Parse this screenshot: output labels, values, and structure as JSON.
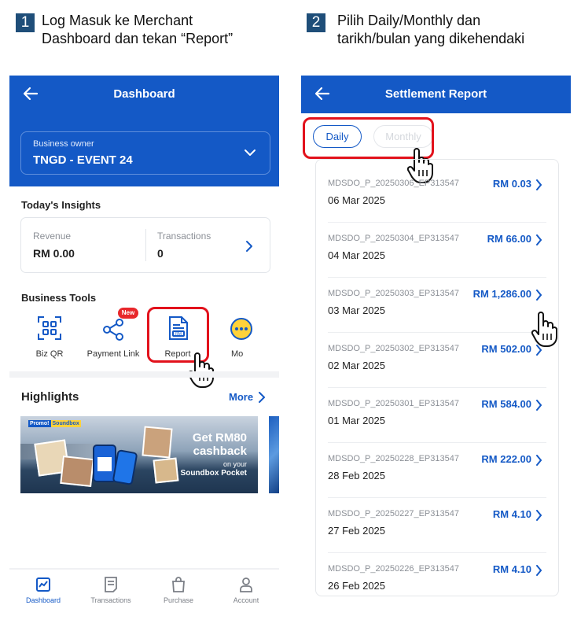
{
  "steps": [
    {
      "num": "1",
      "line1": "Log Masuk ke Merchant",
      "line2": "Dashboard dan tekan “Report”"
    },
    {
      "num": "2",
      "line1": "Pilih Daily/Monthly dan",
      "line2": "tarikh/bulan yang dikehendaki"
    }
  ],
  "dashboard": {
    "title": "Dashboard",
    "business_owner_label": "Business owner",
    "business_owner_value": "TNGD - EVENT 24",
    "insights_title": "Today's Insights",
    "revenue_label": "Revenue",
    "revenue_value": "RM 0.00",
    "transactions_label": "Transactions",
    "transactions_value": "0",
    "tools_title": "Business Tools",
    "tools": [
      {
        "label": "Biz QR",
        "icon": "qr-icon"
      },
      {
        "label": "Payment Link",
        "icon": "share-icon",
        "badge": "New"
      },
      {
        "label": "Report",
        "icon": "report-icon"
      },
      {
        "label": "Mo",
        "icon": "more-icon"
      }
    ],
    "highlights_title": "Highlights",
    "more_label": "More",
    "banner": {
      "promo_tag": "Promo!",
      "promo_brand": "Soundbox",
      "headline1": "Get RM80",
      "headline2": "cashback",
      "sub1": "on your",
      "sub2": "Soundbox Pocket"
    },
    "nav": [
      {
        "label": "Dashboard",
        "icon": "chart-icon",
        "active": true
      },
      {
        "label": "Transactions",
        "icon": "receipt-icon"
      },
      {
        "label": "Purchase",
        "icon": "bag-icon"
      },
      {
        "label": "Account",
        "icon": "person-icon"
      }
    ]
  },
  "settlement": {
    "title": "Settlement Report",
    "tab_daily": "Daily",
    "tab_monthly": "Monthly",
    "rows": [
      {
        "id": "MDSDO_P_20250306_EP313547",
        "date": "06 Mar 2025",
        "amount": "RM 0.03"
      },
      {
        "id": "MDSDO_P_20250304_EP313547",
        "date": "04 Mar 2025",
        "amount": "RM 66.00"
      },
      {
        "id": "MDSDO_P_20250303_EP313547",
        "date": "03 Mar 2025",
        "amount": "RM 1,286.00"
      },
      {
        "id": "MDSDO_P_20250302_EP313547",
        "date": "02 Mar 2025",
        "amount": "RM 502.00"
      },
      {
        "id": "MDSDO_P_20250301_EP313547",
        "date": "01 Mar 2025",
        "amount": "RM 584.00"
      },
      {
        "id": "MDSDO_P_20250228_EP313547",
        "date": "28 Feb 2025",
        "amount": "RM 222.00"
      },
      {
        "id": "MDSDO_P_20250227_EP313547",
        "date": "27 Feb 2025",
        "amount": "RM 4.10"
      },
      {
        "id": "MDSDO_P_20250226_EP313547",
        "date": "26 Feb 2025",
        "amount": "RM 4.10"
      }
    ]
  },
  "colors": {
    "brand_blue": "#1459c6",
    "step_badge": "#1f4e79",
    "highlight_red": "#e2121c"
  }
}
